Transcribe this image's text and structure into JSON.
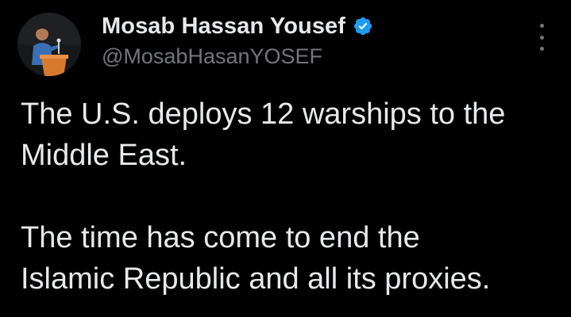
{
  "author": {
    "display_name": "Mosab Hassan Yousef",
    "handle": "@MosabHasanYOSEF",
    "verified": true,
    "avatar_icon": "speaker-at-podium-avatar"
  },
  "tweet": {
    "paragraph_1_line_1": "The U.S. deploys 12 warships to the",
    "paragraph_1_line_2": "Middle East.",
    "paragraph_2_line_1": "The time has come to end the",
    "paragraph_2_line_2": "Islamic Republic and all its proxies."
  },
  "icons": {
    "verified": "verified-badge-icon",
    "more": "more-options-icon"
  },
  "colors": {
    "background": "#000000",
    "primary_text": "#e7e9ea",
    "secondary_text": "#71767b",
    "verified_blue": "#1d9bf0"
  }
}
